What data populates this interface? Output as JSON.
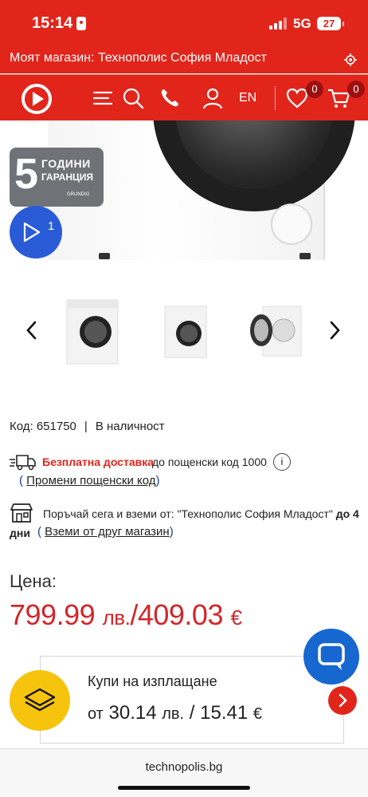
{
  "status_bar": {
    "time": "15:14",
    "network": "5G",
    "battery": "27"
  },
  "store": {
    "label": "Моят магазин: Технополис София Младост"
  },
  "nav": {
    "lang": "EN",
    "wishlist_count": "0",
    "cart_count": "0"
  },
  "hero": {
    "guarantee_number": "5",
    "guarantee_line1": "ГОДИНИ",
    "guarantee_line2": "ГАРАНЦИЯ",
    "guarantee_brand": "GRUNDIG",
    "video_count": "1"
  },
  "product": {
    "code_label": "Код: 651750",
    "separator": "|",
    "availability": "В наличност"
  },
  "delivery": {
    "free_label": "Безплатна доставка",
    "postal_text": "до пощенски код 1000",
    "info_glyph": "i",
    "change_link": "Промени пощенски код"
  },
  "pickup": {
    "text": "Поръчай сега и вземи от:  \"Технополис София Младост\"",
    "deadline_inline": "до 4",
    "deadline_cont": "дни",
    "other_store_link": "Вземи от друг магазин"
  },
  "price": {
    "label": "Цена:",
    "bgn_value": "799.99",
    "bgn_unit": "лв.",
    "divider": "/",
    "eur_value": "409.03",
    "eur_unit": "€"
  },
  "installment": {
    "title": "Купи на изплащане",
    "prefix": "от",
    "bgn": "30.14",
    "bgn_unit": "лв.",
    "divider": "/",
    "eur": "15.41",
    "eur_unit": "€"
  },
  "browser": {
    "url": "technopolis.bg"
  },
  "colors": {
    "brand_red": "#e1251b",
    "price_red": "#d2262a",
    "chat_blue": "#1767d0",
    "play_blue": "#2a5bd7",
    "badge_yellow": "#f6c40c"
  },
  "icons": [
    "logo-icon",
    "menu-icon",
    "search-icon",
    "phone-icon",
    "user-icon",
    "heart-icon",
    "cart-icon",
    "locate-icon",
    "play-icon",
    "chevron-left-icon",
    "chevron-right-icon",
    "truck-icon",
    "info-icon",
    "shop-icon",
    "layers-icon",
    "chat-icon",
    "chevron-right-icon"
  ]
}
